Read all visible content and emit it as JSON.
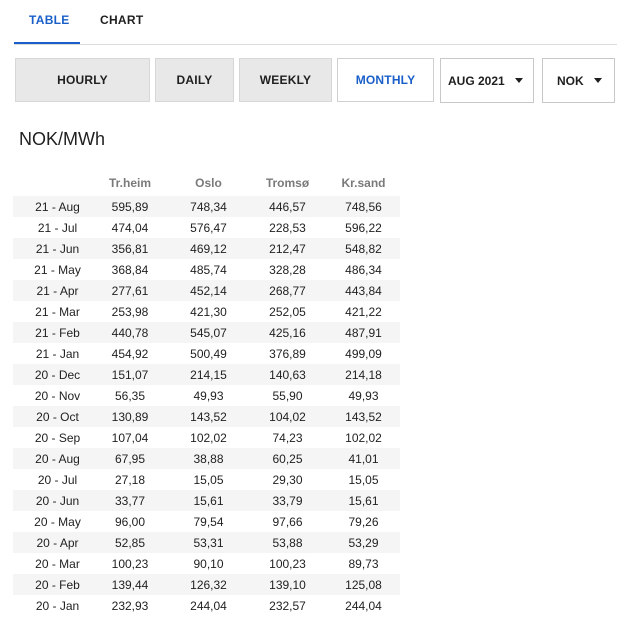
{
  "tabs": {
    "table": "TABLE",
    "chart": "CHART"
  },
  "periods": {
    "hourly": "HOURLY",
    "daily": "DAILY",
    "weekly": "WEEKLY",
    "monthly": "MONTHLY"
  },
  "month_select": {
    "value": "AUG 2021"
  },
  "currency_select": {
    "value": "NOK"
  },
  "unit_title": "NOK/MWh",
  "table": {
    "headers": [
      "",
      "Tr.heim",
      "Oslo",
      "Tromsø",
      "Kr.sand"
    ],
    "rows": [
      [
        "21 - Aug",
        "595,89",
        "748,34",
        "446,57",
        "748,56"
      ],
      [
        "21 - Jul",
        "474,04",
        "576,47",
        "228,53",
        "596,22"
      ],
      [
        "21 - Jun",
        "356,81",
        "469,12",
        "212,47",
        "548,82"
      ],
      [
        "21 - May",
        "368,84",
        "485,74",
        "328,28",
        "486,34"
      ],
      [
        "21 - Apr",
        "277,61",
        "452,14",
        "268,77",
        "443,84"
      ],
      [
        "21 - Mar",
        "253,98",
        "421,30",
        "252,05",
        "421,22"
      ],
      [
        "21 - Feb",
        "440,78",
        "545,07",
        "425,16",
        "487,91"
      ],
      [
        "21 - Jan",
        "454,92",
        "500,49",
        "376,89",
        "499,09"
      ],
      [
        "20 - Dec",
        "151,07",
        "214,15",
        "140,63",
        "214,18"
      ],
      [
        "20 - Nov",
        "56,35",
        "49,93",
        "55,90",
        "49,93"
      ],
      [
        "20 - Oct",
        "130,89",
        "143,52",
        "104,02",
        "143,52"
      ],
      [
        "20 - Sep",
        "107,04",
        "102,02",
        "74,23",
        "102,02"
      ],
      [
        "20 - Aug",
        "67,95",
        "38,88",
        "60,25",
        "41,01"
      ],
      [
        "20 - Jul",
        "27,18",
        "15,05",
        "29,30",
        "15,05"
      ],
      [
        "20 - Jun",
        "33,77",
        "15,61",
        "33,79",
        "15,61"
      ],
      [
        "20 - May",
        "96,00",
        "79,54",
        "97,66",
        "79,26"
      ],
      [
        "20 - Apr",
        "52,85",
        "53,31",
        "53,88",
        "53,29"
      ],
      [
        "20 - Mar",
        "100,23",
        "90,10",
        "100,23",
        "89,73"
      ],
      [
        "20 - Feb",
        "139,44",
        "126,32",
        "139,10",
        "125,08"
      ],
      [
        "20 - Jan",
        "232,93",
        "244,04",
        "232,57",
        "244,04"
      ]
    ]
  },
  "colors": {
    "accent": "#1a5fc9",
    "button_gray": "#e8e8e8",
    "row_stripe": "#f5f5f5"
  }
}
